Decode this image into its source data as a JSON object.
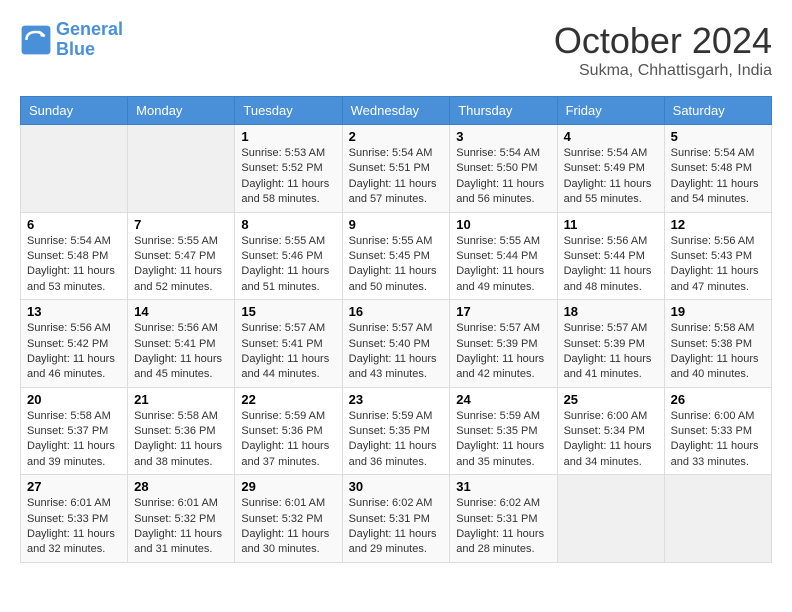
{
  "logo": {
    "line1": "General",
    "line2": "Blue"
  },
  "title": "October 2024",
  "location": "Sukma, Chhattisgarh, India",
  "headers": [
    "Sunday",
    "Monday",
    "Tuesday",
    "Wednesday",
    "Thursday",
    "Friday",
    "Saturday"
  ],
  "weeks": [
    [
      {
        "day": "",
        "info": ""
      },
      {
        "day": "",
        "info": ""
      },
      {
        "day": "1",
        "sunrise": "Sunrise: 5:53 AM",
        "sunset": "Sunset: 5:52 PM",
        "daylight": "Daylight: 11 hours and 58 minutes."
      },
      {
        "day": "2",
        "sunrise": "Sunrise: 5:54 AM",
        "sunset": "Sunset: 5:51 PM",
        "daylight": "Daylight: 11 hours and 57 minutes."
      },
      {
        "day": "3",
        "sunrise": "Sunrise: 5:54 AM",
        "sunset": "Sunset: 5:50 PM",
        "daylight": "Daylight: 11 hours and 56 minutes."
      },
      {
        "day": "4",
        "sunrise": "Sunrise: 5:54 AM",
        "sunset": "Sunset: 5:49 PM",
        "daylight": "Daylight: 11 hours and 55 minutes."
      },
      {
        "day": "5",
        "sunrise": "Sunrise: 5:54 AM",
        "sunset": "Sunset: 5:48 PM",
        "daylight": "Daylight: 11 hours and 54 minutes."
      }
    ],
    [
      {
        "day": "6",
        "sunrise": "Sunrise: 5:54 AM",
        "sunset": "Sunset: 5:48 PM",
        "daylight": "Daylight: 11 hours and 53 minutes."
      },
      {
        "day": "7",
        "sunrise": "Sunrise: 5:55 AM",
        "sunset": "Sunset: 5:47 PM",
        "daylight": "Daylight: 11 hours and 52 minutes."
      },
      {
        "day": "8",
        "sunrise": "Sunrise: 5:55 AM",
        "sunset": "Sunset: 5:46 PM",
        "daylight": "Daylight: 11 hours and 51 minutes."
      },
      {
        "day": "9",
        "sunrise": "Sunrise: 5:55 AM",
        "sunset": "Sunset: 5:45 PM",
        "daylight": "Daylight: 11 hours and 50 minutes."
      },
      {
        "day": "10",
        "sunrise": "Sunrise: 5:55 AM",
        "sunset": "Sunset: 5:44 PM",
        "daylight": "Daylight: 11 hours and 49 minutes."
      },
      {
        "day": "11",
        "sunrise": "Sunrise: 5:56 AM",
        "sunset": "Sunset: 5:44 PM",
        "daylight": "Daylight: 11 hours and 48 minutes."
      },
      {
        "day": "12",
        "sunrise": "Sunrise: 5:56 AM",
        "sunset": "Sunset: 5:43 PM",
        "daylight": "Daylight: 11 hours and 47 minutes."
      }
    ],
    [
      {
        "day": "13",
        "sunrise": "Sunrise: 5:56 AM",
        "sunset": "Sunset: 5:42 PM",
        "daylight": "Daylight: 11 hours and 46 minutes."
      },
      {
        "day": "14",
        "sunrise": "Sunrise: 5:56 AM",
        "sunset": "Sunset: 5:41 PM",
        "daylight": "Daylight: 11 hours and 45 minutes."
      },
      {
        "day": "15",
        "sunrise": "Sunrise: 5:57 AM",
        "sunset": "Sunset: 5:41 PM",
        "daylight": "Daylight: 11 hours and 44 minutes."
      },
      {
        "day": "16",
        "sunrise": "Sunrise: 5:57 AM",
        "sunset": "Sunset: 5:40 PM",
        "daylight": "Daylight: 11 hours and 43 minutes."
      },
      {
        "day": "17",
        "sunrise": "Sunrise: 5:57 AM",
        "sunset": "Sunset: 5:39 PM",
        "daylight": "Daylight: 11 hours and 42 minutes."
      },
      {
        "day": "18",
        "sunrise": "Sunrise: 5:57 AM",
        "sunset": "Sunset: 5:39 PM",
        "daylight": "Daylight: 11 hours and 41 minutes."
      },
      {
        "day": "19",
        "sunrise": "Sunrise: 5:58 AM",
        "sunset": "Sunset: 5:38 PM",
        "daylight": "Daylight: 11 hours and 40 minutes."
      }
    ],
    [
      {
        "day": "20",
        "sunrise": "Sunrise: 5:58 AM",
        "sunset": "Sunset: 5:37 PM",
        "daylight": "Daylight: 11 hours and 39 minutes."
      },
      {
        "day": "21",
        "sunrise": "Sunrise: 5:58 AM",
        "sunset": "Sunset: 5:36 PM",
        "daylight": "Daylight: 11 hours and 38 minutes."
      },
      {
        "day": "22",
        "sunrise": "Sunrise: 5:59 AM",
        "sunset": "Sunset: 5:36 PM",
        "daylight": "Daylight: 11 hours and 37 minutes."
      },
      {
        "day": "23",
        "sunrise": "Sunrise: 5:59 AM",
        "sunset": "Sunset: 5:35 PM",
        "daylight": "Daylight: 11 hours and 36 minutes."
      },
      {
        "day": "24",
        "sunrise": "Sunrise: 5:59 AM",
        "sunset": "Sunset: 5:35 PM",
        "daylight": "Daylight: 11 hours and 35 minutes."
      },
      {
        "day": "25",
        "sunrise": "Sunrise: 6:00 AM",
        "sunset": "Sunset: 5:34 PM",
        "daylight": "Daylight: 11 hours and 34 minutes."
      },
      {
        "day": "26",
        "sunrise": "Sunrise: 6:00 AM",
        "sunset": "Sunset: 5:33 PM",
        "daylight": "Daylight: 11 hours and 33 minutes."
      }
    ],
    [
      {
        "day": "27",
        "sunrise": "Sunrise: 6:01 AM",
        "sunset": "Sunset: 5:33 PM",
        "daylight": "Daylight: 11 hours and 32 minutes."
      },
      {
        "day": "28",
        "sunrise": "Sunrise: 6:01 AM",
        "sunset": "Sunset: 5:32 PM",
        "daylight": "Daylight: 11 hours and 31 minutes."
      },
      {
        "day": "29",
        "sunrise": "Sunrise: 6:01 AM",
        "sunset": "Sunset: 5:32 PM",
        "daylight": "Daylight: 11 hours and 30 minutes."
      },
      {
        "day": "30",
        "sunrise": "Sunrise: 6:02 AM",
        "sunset": "Sunset: 5:31 PM",
        "daylight": "Daylight: 11 hours and 29 minutes."
      },
      {
        "day": "31",
        "sunrise": "Sunrise: 6:02 AM",
        "sunset": "Sunset: 5:31 PM",
        "daylight": "Daylight: 11 hours and 28 minutes."
      },
      {
        "day": "",
        "info": ""
      },
      {
        "day": "",
        "info": ""
      }
    ]
  ]
}
